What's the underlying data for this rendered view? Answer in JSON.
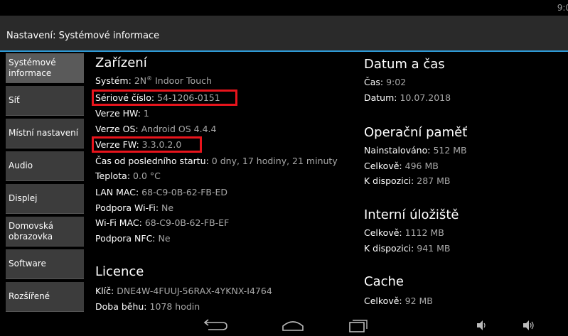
{
  "status": {
    "time": "9:0"
  },
  "header": {
    "title": "Nastavení: Systémové informace"
  },
  "sidebar": {
    "items": [
      {
        "label": "Systémové\ninformace"
      },
      {
        "label": "Síť"
      },
      {
        "label": "Místní nastavení"
      },
      {
        "label": "Audio"
      },
      {
        "label": "Displej"
      },
      {
        "label": "Domovská\nobrazovka"
      },
      {
        "label": "Software"
      },
      {
        "label": "Rozšířené"
      }
    ]
  },
  "device": {
    "title": "Zařízení",
    "system_key": "Systém:",
    "system_val": "2N",
    "system_sup": "®",
    "system_val2": " Indoor Touch",
    "serial_key": "Sériové číslo:",
    "serial_val": "54-1206-0151",
    "hw_key": "Verze HW:",
    "hw_val": "1",
    "os_key": "Verze OS:",
    "os_val": "Android OS 4.4.4",
    "fw_key": "Verze FW:",
    "fw_val": "3.3.0.2.0",
    "uptime_key": "Čas od posledního startu:",
    "uptime_val": "0 dny, 17 hodiny, 21 minuty",
    "temp_key": "Teplota:",
    "temp_val": "0.0 °C",
    "lanmac_key": "LAN MAC:",
    "lanmac_val": "68-C9-0B-62-FB-ED",
    "wifi_key": "Podpora Wi-Fi:",
    "wifi_val": "Ne",
    "wifimac_key": "Wi-Fi MAC:",
    "wifimac_val": "68-C9-0B-62-FB-EF",
    "nfc_key": "Podpora NFC:",
    "nfc_val": "Ne"
  },
  "license": {
    "title": "Licence",
    "key_key": "Klíč:",
    "key_val": "DNE4W-4FUUJ-56RAX-4YKNX-I4764",
    "runtime_key": "Doba běhu:",
    "runtime_val": "1078 hodin"
  },
  "datetime": {
    "title": "Datum a čas",
    "time_key": "Čas:",
    "time_val": "9:02",
    "date_key": "Datum:",
    "date_val": "10.07.2018"
  },
  "memory": {
    "title": "Operační paměť",
    "installed_key": "Nainstalováno:",
    "installed_val": "512 MB",
    "total_key": "Celkově:",
    "total_val": "496 MB",
    "avail_key": "K dispozici:",
    "avail_val": "287 MB"
  },
  "storage": {
    "title": "Interní úložiště",
    "total_key": "Celkově:",
    "total_val": "1112 MB",
    "avail_key": "K dispozici:",
    "avail_val": "941 MB"
  },
  "cache": {
    "title": "Cache",
    "total_key": "Celkově:",
    "total_val": "92 MB"
  },
  "navbar": {
    "icons": [
      "back-icon",
      "home-icon",
      "recent-apps-icon",
      "volume-down-icon",
      "volume-up-icon"
    ]
  },
  "colors": {
    "accent": "#2e9ad6",
    "highlight": "#e8141c"
  }
}
